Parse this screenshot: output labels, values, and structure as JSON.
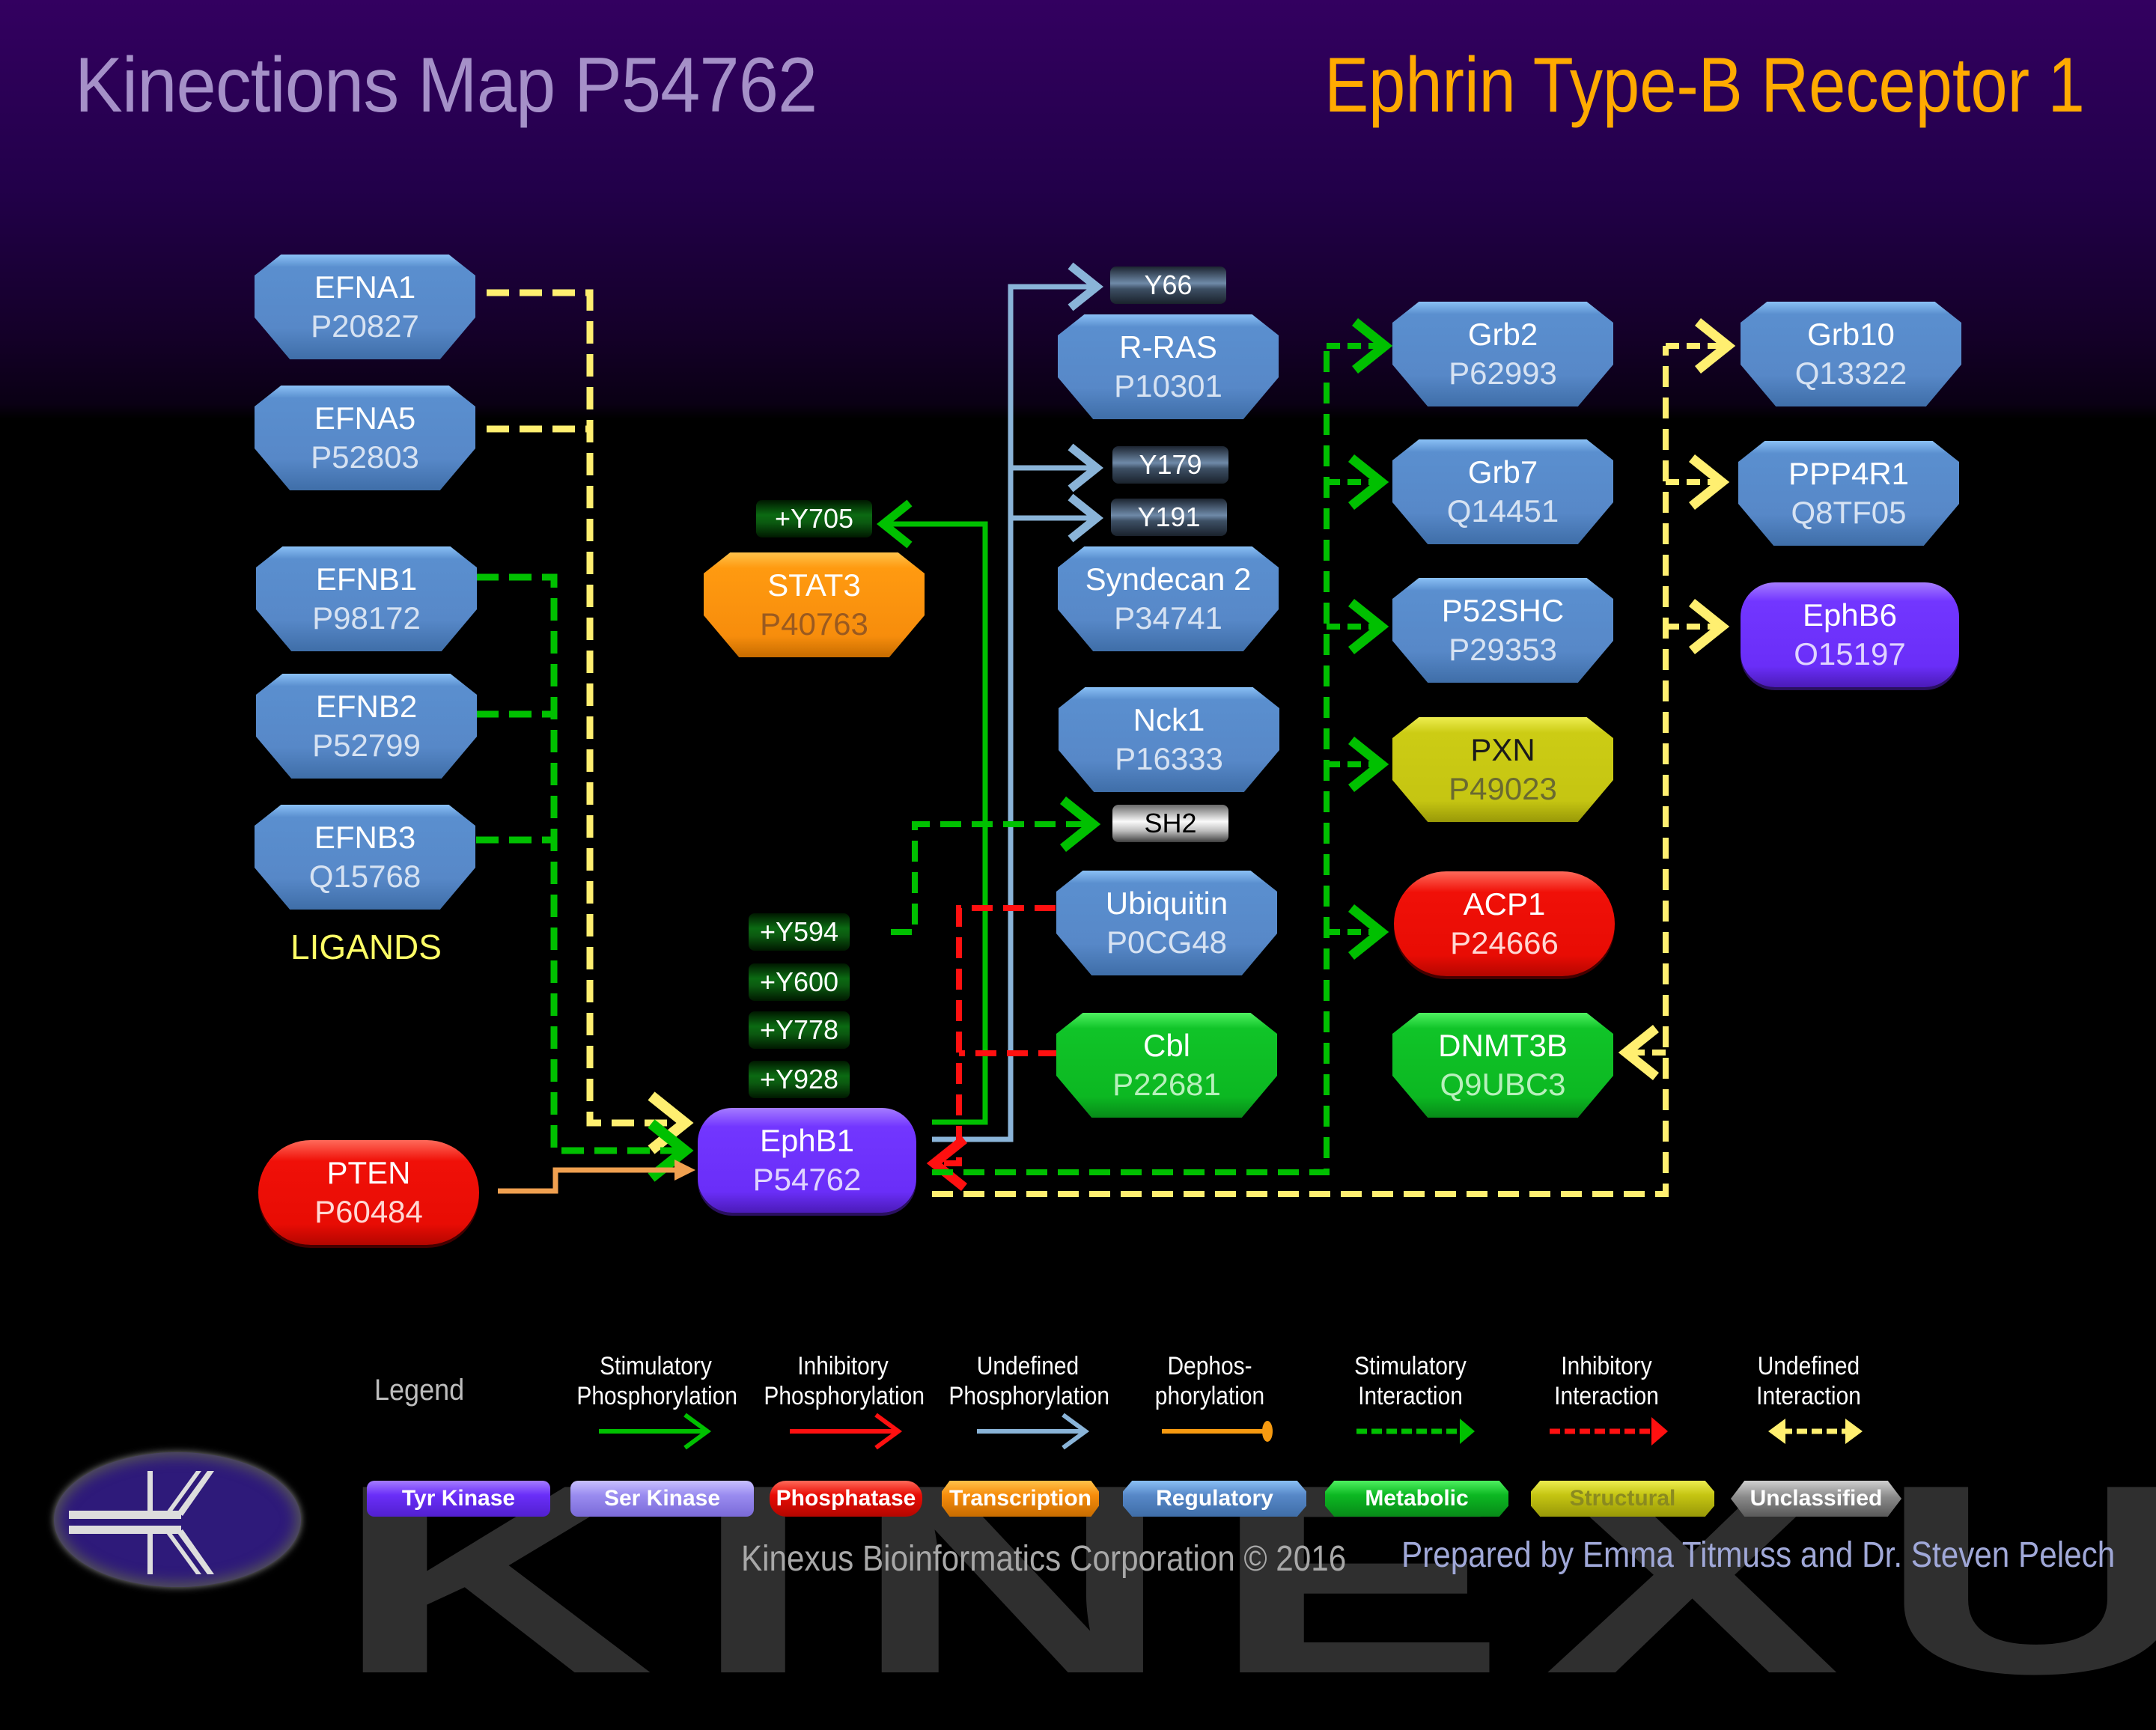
{
  "header": {
    "title": "Kinections Map P54762",
    "protein_name": "Ephrin Type-B Receptor 1"
  },
  "colors": {
    "tyr_kinase": "#6a2ef8",
    "ser_kinase": "#9a8cf0",
    "phosphatase": "#e80c04",
    "transcription": "#f78d0c",
    "regulatory": "#5788c8",
    "metabolic": "#0cb822",
    "structural": "#c5c512",
    "unclassified": "#8a8a8a",
    "stim_phos": "#00c000",
    "inhib_phos": "#ff1010",
    "undef_phos": "#8ab4d8",
    "dephos": "#f0a050",
    "stim_int": "#00c000",
    "inhib_int": "#ff1010",
    "undef_int": "#ffef70"
  },
  "ligands_label": "LIGANDS",
  "nodes": {
    "efna1": {
      "name": "EFNA1",
      "id": "P20827",
      "category": "regulatory"
    },
    "efna5": {
      "name": "EFNA5",
      "id": "P52803",
      "category": "regulatory"
    },
    "efnb1": {
      "name": "EFNB1",
      "id": "P98172",
      "category": "regulatory"
    },
    "efnb2": {
      "name": "EFNB2",
      "id": "P52799",
      "category": "regulatory"
    },
    "efnb3": {
      "name": "EFNB3",
      "id": "Q15768",
      "category": "regulatory"
    },
    "pten": {
      "name": "PTEN",
      "id": "P60484",
      "category": "phosphatase"
    },
    "ephb1": {
      "name": "EphB1",
      "id": "P54762",
      "category": "tyr_kinase"
    },
    "stat3": {
      "name": "STAT3",
      "id": "P40763",
      "category": "transcription"
    },
    "rras": {
      "name": "R-RAS",
      "id": "P10301",
      "category": "regulatory"
    },
    "syndecan2": {
      "name": "Syndecan 2",
      "id": "P34741",
      "category": "regulatory"
    },
    "nck1": {
      "name": "Nck1",
      "id": "P16333",
      "category": "regulatory"
    },
    "ubiquitin": {
      "name": "Ubiquitin",
      "id": "P0CG48",
      "category": "regulatory"
    },
    "cbl": {
      "name": "Cbl",
      "id": "P22681",
      "category": "metabolic"
    },
    "grb2": {
      "name": "Grb2",
      "id": "P62993",
      "category": "regulatory"
    },
    "grb7": {
      "name": "Grb7",
      "id": "Q14451",
      "category": "regulatory"
    },
    "p52shc": {
      "name": "P52SHC",
      "id": "P29353",
      "category": "regulatory"
    },
    "pxn": {
      "name": "PXN",
      "id": "P49023",
      "category": "structural"
    },
    "acp1": {
      "name": "ACP1",
      "id": "P24666",
      "category": "phosphatase"
    },
    "dnmt3b": {
      "name": "DNMT3B",
      "id": "Q9UBC3",
      "category": "metabolic"
    },
    "grb10": {
      "name": "Grb10",
      "id": "Q13322",
      "category": "regulatory"
    },
    "ppp4r1": {
      "name": "PPP4R1",
      "id": "Q8TF05",
      "category": "regulatory"
    },
    "ephb6": {
      "name": "EphB6",
      "id": "O15197",
      "category": "tyr_kinase"
    }
  },
  "sites": {
    "y66": "Y66",
    "y179": "Y179",
    "y191": "Y191",
    "y705": "+Y705",
    "sh2": "SH2",
    "y594": "+Y594",
    "y600": "+Y600",
    "y778": "+Y778",
    "y928": "+Y928"
  },
  "edges": [
    {
      "from": "EFNA1",
      "to": "EphB1",
      "type": "undefined_interaction"
    },
    {
      "from": "EFNA5",
      "to": "EphB1",
      "type": "undefined_interaction"
    },
    {
      "from": "EFNB1",
      "to": "EphB1",
      "type": "stimulatory_interaction"
    },
    {
      "from": "EFNB2",
      "to": "EphB1",
      "type": "stimulatory_interaction"
    },
    {
      "from": "EFNB3",
      "to": "EphB1",
      "type": "stimulatory_interaction"
    },
    {
      "from": "PTEN",
      "to": "EphB1",
      "type": "dephosphorylation"
    },
    {
      "from": "EphB1",
      "to": "STAT3",
      "site": "+Y705",
      "type": "stimulatory_phosphorylation"
    },
    {
      "from": "EphB1",
      "to": "R-RAS",
      "site": "Y66",
      "type": "undefined_phosphorylation"
    },
    {
      "from": "EphB1",
      "to": "Syndecan 2",
      "site": "Y179",
      "type": "undefined_phosphorylation"
    },
    {
      "from": "EphB1",
      "to": "Syndecan 2",
      "site": "Y191",
      "type": "undefined_phosphorylation"
    },
    {
      "from": "EphB1 +Y594",
      "to": "Nck1 SH2",
      "type": "stimulatory_interaction"
    },
    {
      "from": "Ubiquitin",
      "to": "EphB1",
      "type": "inhibitory_interaction"
    },
    {
      "from": "Cbl",
      "to": "EphB1",
      "type": "inhibitory_interaction"
    },
    {
      "from": "EphB1",
      "to": "Grb2",
      "type": "stimulatory_interaction"
    },
    {
      "from": "EphB1",
      "to": "Grb7",
      "type": "stimulatory_interaction"
    },
    {
      "from": "EphB1",
      "to": "P52SHC",
      "type": "stimulatory_interaction"
    },
    {
      "from": "EphB1",
      "to": "PXN",
      "type": "stimulatory_interaction"
    },
    {
      "from": "EphB1",
      "to": "ACP1",
      "type": "stimulatory_interaction"
    },
    {
      "from": "EphB1",
      "to": "Grb10",
      "type": "undefined_interaction"
    },
    {
      "from": "EphB1",
      "to": "PPP4R1",
      "type": "undefined_interaction"
    },
    {
      "from": "EphB1",
      "to": "EphB6",
      "type": "undefined_interaction"
    },
    {
      "from": "EphB1",
      "to": "DNMT3B",
      "type": "undefined_interaction"
    }
  ],
  "legend": {
    "title": "Legend",
    "edge_types": [
      {
        "line1": "Stimulatory",
        "line2": "Phosphorylation"
      },
      {
        "line1": "Inhibitory",
        "line2": "Phosphorylation"
      },
      {
        "line1": "Undefined",
        "line2": "Phosphorylation"
      },
      {
        "line1": "Dephos-",
        "line2": "phorylation"
      },
      {
        "line1": "Stimulatory",
        "line2": "Interaction"
      },
      {
        "line1": "Inhibitory",
        "line2": "Interaction"
      },
      {
        "line1": "Undefined",
        "line2": "Interaction"
      }
    ],
    "categories": [
      "Tyr Kinase",
      "Ser Kinase",
      "Phosphatase",
      "Transcription",
      "Regulatory",
      "Metabolic",
      "Structural",
      "Unclassified"
    ]
  },
  "watermark": "KINEXUS",
  "footer": {
    "copyright": "Kinexus Bioinformatics Corporation © 2016",
    "credits": "Prepared by Emma Titmuss and Dr. Steven Pelech"
  }
}
